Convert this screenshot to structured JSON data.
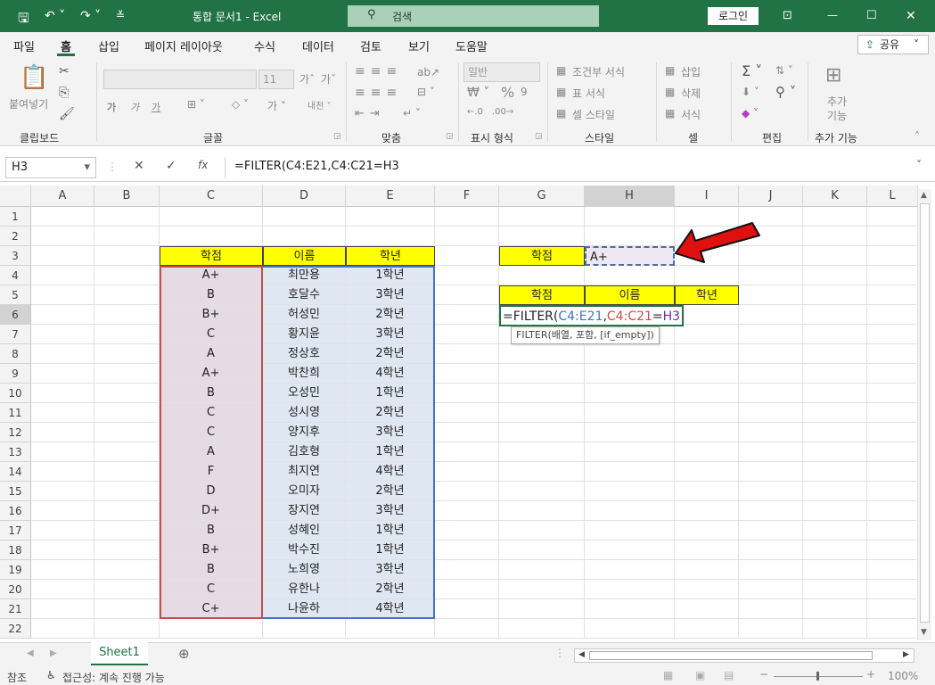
{
  "window": {
    "app_title": "통합 문서1  -  Excel",
    "search_label": "검색",
    "login_label": "로그인"
  },
  "tabs": [
    "파일",
    "홈",
    "삽입",
    "페이지 레이아웃",
    "수식",
    "데이터",
    "검토",
    "보기",
    "도움말"
  ],
  "active_tab": "홈",
  "share_label": "공유",
  "ribbon": {
    "clipboard": {
      "group": "클립보드",
      "paste": "붙여넣기"
    },
    "font": {
      "group": "글꼴",
      "size": "11",
      "bold": "가",
      "italic": "가",
      "underline": "가"
    },
    "alignment": {
      "group": "맞춤"
    },
    "number": {
      "group": "표시 형식",
      "format": "일반"
    },
    "styles": {
      "group": "스타일",
      "conditional": "조건부 서식",
      "table": "표 서식",
      "cell": "셀 스타일"
    },
    "cells": {
      "group": "셀",
      "insert": "삽입",
      "delete": "삭제",
      "format": "서식"
    },
    "editing": {
      "group": "편집"
    },
    "addins": {
      "group": "추가 기능",
      "label": "추가 기능"
    }
  },
  "formula_bar": {
    "name_box": "H3",
    "formula": "=FILTER(C4:E21,C4:C21=H3"
  },
  "columns": [
    "A",
    "B",
    "C",
    "D",
    "E",
    "F",
    "G",
    "H",
    "I",
    "J",
    "K",
    "L"
  ],
  "row_numbers": [
    "1",
    "2",
    "3",
    "4",
    "5",
    "6",
    "7",
    "8",
    "9",
    "10",
    "11",
    "12",
    "13",
    "14",
    "15",
    "16",
    "17",
    "18",
    "19",
    "20",
    "21",
    "22"
  ],
  "table": {
    "headers": [
      "학점",
      "이름",
      "학년"
    ],
    "rows": [
      [
        "A+",
        "최만용",
        "1학년"
      ],
      [
        "B",
        "호달수",
        "3학년"
      ],
      [
        "B+",
        "허성민",
        "2학년"
      ],
      [
        "C",
        "황지윤",
        "3학년"
      ],
      [
        "A",
        "정상호",
        "2학년"
      ],
      [
        "A+",
        "박찬희",
        "4학년"
      ],
      [
        "B",
        "오성민",
        "1학년"
      ],
      [
        "C",
        "성시영",
        "2학년"
      ],
      [
        "C",
        "양지후",
        "3학년"
      ],
      [
        "A",
        "김호형",
        "1학년"
      ],
      [
        "F",
        "최지연",
        "4학년"
      ],
      [
        "D",
        "오미자",
        "2학년"
      ],
      [
        "D+",
        "장지연",
        "3학년"
      ],
      [
        "B",
        "성혜인",
        "1학년"
      ],
      [
        "B+",
        "박수진",
        "1학년"
      ],
      [
        "B",
        "노희영",
        "3학년"
      ],
      [
        "C",
        "유한나",
        "2학년"
      ],
      [
        "C+",
        "나윤하",
        "4학년"
      ]
    ]
  },
  "criteria": {
    "label": "학점",
    "value": "A+"
  },
  "result_headers": [
    "학점",
    "이름",
    "학년"
  ],
  "edit_cell": {
    "prefix": "=FILTER(",
    "ref1": "C4:E21",
    "comma": ",",
    "ref2": "C4:C21",
    "eq": "=",
    "ref3": "H3"
  },
  "tooltip": "FILTER(배열, 포함, [if_empty])",
  "sheet_tab": "Sheet1",
  "status": {
    "mode": "참조",
    "accessibility": "접근성: 계속 진행 가능",
    "zoom": "100%"
  },
  "colors": {
    "excel_green": "#217346",
    "header_yellow": "#ffff00",
    "ref_red": "#c0504d",
    "ref_blue": "#4472c4",
    "ref_purple": "#7030a0",
    "arrow_red": "#e01010"
  }
}
